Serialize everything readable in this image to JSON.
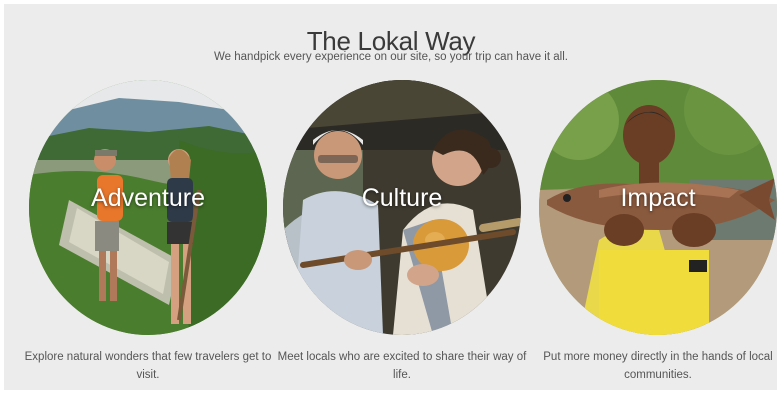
{
  "header": {
    "title": "The Lokal Way",
    "subtitle": "We handpick every experience on our site, so your trip can have it all."
  },
  "cards": [
    {
      "label": "Adventure",
      "description": "Explore natural wonders that few travelers get to visit."
    },
    {
      "label": "Culture",
      "description": "Meet locals who are excited to share their way of life."
    },
    {
      "label": "Impact",
      "description": "Put more money directly in the hands of local communities."
    }
  ]
}
